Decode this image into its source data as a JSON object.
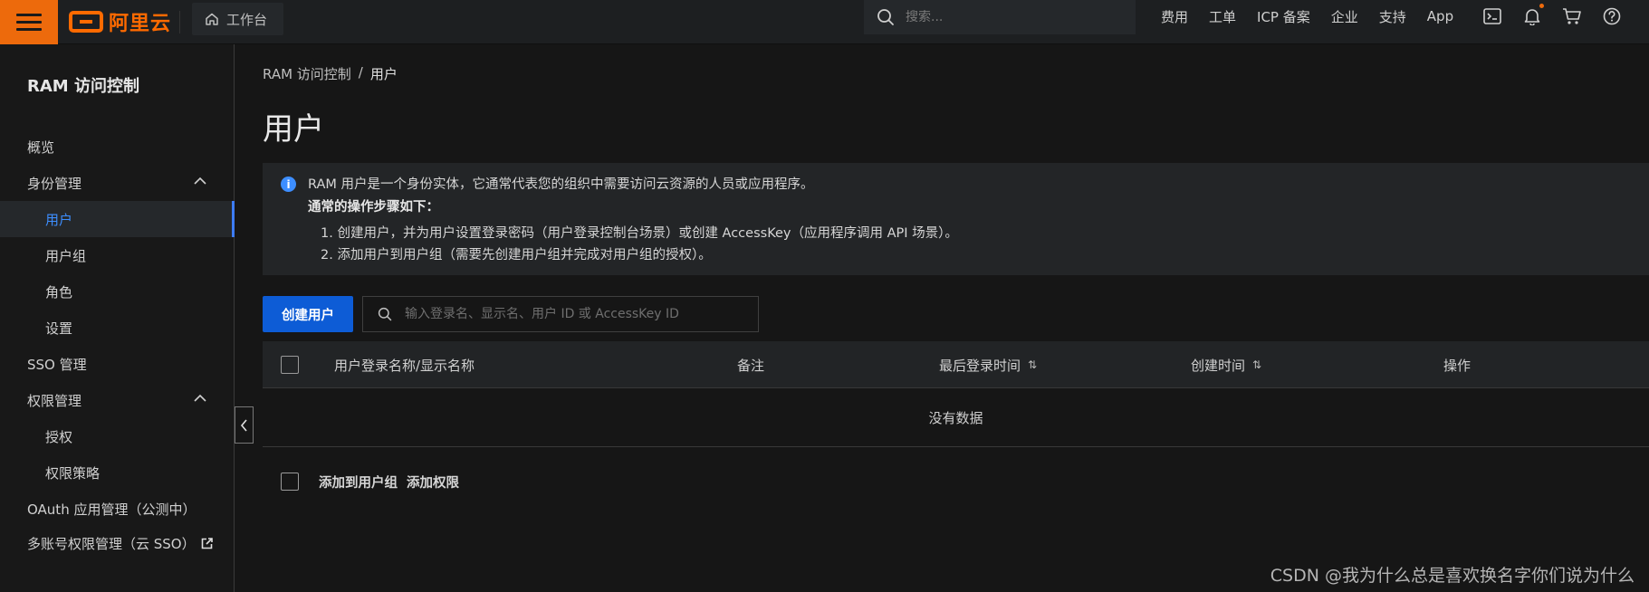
{
  "topbar": {
    "brand": "阿里云",
    "workbench_label": "工作台",
    "search_placeholder": "搜索...",
    "nav_links": [
      "费用",
      "工单",
      "ICP 备案",
      "企业",
      "支持",
      "App"
    ]
  },
  "sidebar": {
    "title": "RAM 访问控制",
    "items": [
      {
        "label": "概览"
      },
      {
        "label": "身份管理"
      },
      {
        "label": "用户"
      },
      {
        "label": "用户组"
      },
      {
        "label": "角色"
      },
      {
        "label": "设置"
      },
      {
        "label": "SSO 管理"
      },
      {
        "label": "权限管理"
      },
      {
        "label": "授权"
      },
      {
        "label": "权限策略"
      },
      {
        "label": "OAuth 应用管理（公测中）"
      },
      {
        "label": "多账号权限管理（云 SSO）"
      }
    ]
  },
  "breadcrumb": {
    "root": "RAM 访问控制",
    "sep": "/",
    "current": "用户"
  },
  "page_title": "用户",
  "info": {
    "line1": "RAM 用户是一个身份实体，它通常代表您的组织中需要访问云资源的人员或应用程序。",
    "line2": "通常的操作步骤如下：",
    "line3": "1. 创建用户，并为用户设置登录密码（用户登录控制台场景）或创建 AccessKey（应用程序调用 API 场景）。",
    "line4": "2. 添加用户到用户组（需要先创建用户组并完成对用户组的授权）。"
  },
  "toolbar": {
    "create_label": "创建用户",
    "search_placeholder": "输入登录名、显示名、用户 ID 或 AccessKey ID"
  },
  "table": {
    "columns": [
      "用户登录名称/显示名称",
      "备注",
      "最后登录时间",
      "创建时间",
      "操作"
    ],
    "empty_text": "没有数据"
  },
  "bulk": {
    "add_to_group": "添加到用户组",
    "add_permission": "添加权限"
  },
  "watermark": "CSDN @我为什么总是喜欢换名字你们说为什么",
  "colors": {
    "accent_orange": "#ed6a0c",
    "primary_blue": "#0d5cd6",
    "active_blue": "#3d8eff"
  }
}
